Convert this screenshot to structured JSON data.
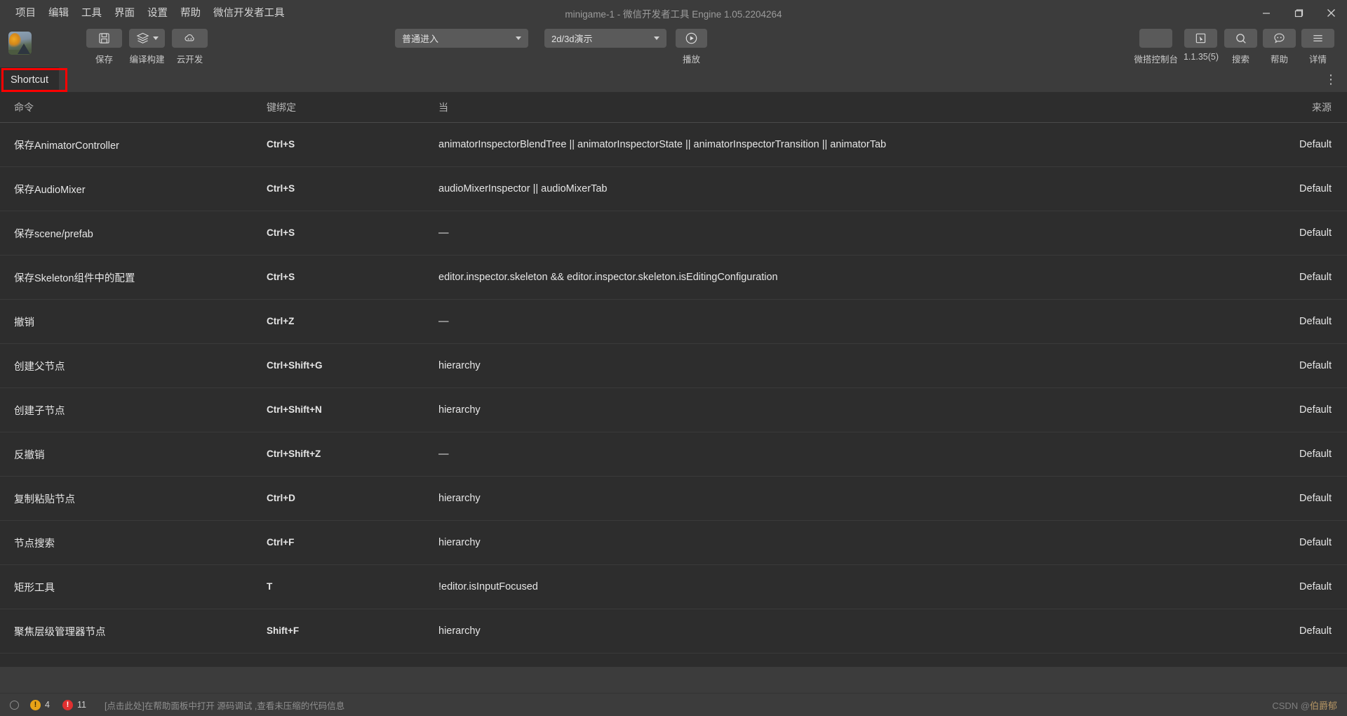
{
  "window": {
    "title": "minigame-1  -  微信开发者工具 Engine 1.05.2204264",
    "menus": [
      "项目",
      "编辑",
      "工具",
      "界面",
      "设置",
      "帮助",
      "微信开发者工具"
    ],
    "controls": {
      "minimize": "minimize-icon",
      "maximize": "maximize-icon",
      "close": "close-icon"
    }
  },
  "toolbar": {
    "avatar_alt": "user-avatar",
    "left_items": [
      {
        "label": "保存",
        "icon": "save-floppy-icon",
        "has_caret": false
      },
      {
        "label": "编译构建",
        "icon": "layers-icon",
        "has_caret": true
      },
      {
        "label": "云开发",
        "icon": "cloud-icon",
        "has_caret": false
      }
    ],
    "mode_select": {
      "value": "普通进入"
    },
    "preview_select": {
      "value": "2d/3d演示"
    },
    "play": {
      "label": "播放",
      "icon": "play-circle-icon"
    },
    "right_items": [
      {
        "label": "微搭控制台",
        "icon": "blank-icon"
      },
      {
        "label": "1.1.35(5)",
        "icon": "cursor-box-icon"
      },
      {
        "label": "搜索",
        "icon": "search-icon"
      },
      {
        "label": "帮助",
        "icon": "speech-bubble-icon"
      },
      {
        "label": "详情",
        "icon": "hamburger-icon"
      }
    ]
  },
  "panel": {
    "active_tab": "Shortcut",
    "more_menu": "⋮"
  },
  "table": {
    "columns": [
      "命令",
      "键绑定",
      "当",
      "来源"
    ],
    "rows": [
      {
        "command": "保存AnimatorController",
        "keybinding": "Ctrl+S",
        "when": "animatorInspectorBlendTree || animatorInspectorState || animatorInspectorTransition || animatorTab",
        "source": "Default"
      },
      {
        "command": "保存AudioMixer",
        "keybinding": "Ctrl+S",
        "when": "audioMixerInspector || audioMixerTab",
        "source": "Default"
      },
      {
        "command": "保存scene/prefab",
        "keybinding": "Ctrl+S",
        "when": "—",
        "source": "Default"
      },
      {
        "command": "保存Skeleton组件中的配置",
        "keybinding": "Ctrl+S",
        "when": "editor.inspector.skeleton && editor.inspector.skeleton.isEditingConfiguration",
        "source": "Default"
      },
      {
        "command": "撤销",
        "keybinding": "Ctrl+Z",
        "when": "—",
        "source": "Default"
      },
      {
        "command": "创建父节点",
        "keybinding": "Ctrl+Shift+G",
        "when": "hierarchy",
        "source": "Default"
      },
      {
        "command": "创建子节点",
        "keybinding": "Ctrl+Shift+N",
        "when": "hierarchy",
        "source": "Default"
      },
      {
        "command": "反撤销",
        "keybinding": "Ctrl+Shift+Z",
        "when": "—",
        "source": "Default"
      },
      {
        "command": "复制粘贴节点",
        "keybinding": "Ctrl+D",
        "when": "hierarchy",
        "source": "Default"
      },
      {
        "command": "节点搜索",
        "keybinding": "Ctrl+F",
        "when": "hierarchy",
        "source": "Default"
      },
      {
        "command": "矩形工具",
        "keybinding": "T",
        "when": "!editor.isInputFocused",
        "source": "Default"
      },
      {
        "command": "聚焦层级管理器节点",
        "keybinding": "Shift+F",
        "when": "hierarchy",
        "source": "Default"
      }
    ]
  },
  "statusbar": {
    "warning_count": "4",
    "error_count": "11",
    "message": "[点击此处]在帮助面板中打开 源码调试 ,查看未压缩的代码信息",
    "watermark_prefix": "CSDN @",
    "watermark_accent": "伯爵郁"
  },
  "colors": {
    "window_bg": "#3c3c3c",
    "panel_bg": "#2d2d2d",
    "accent_red": "#ff0000",
    "warning": "#e8a317",
    "error": "#e03030"
  }
}
